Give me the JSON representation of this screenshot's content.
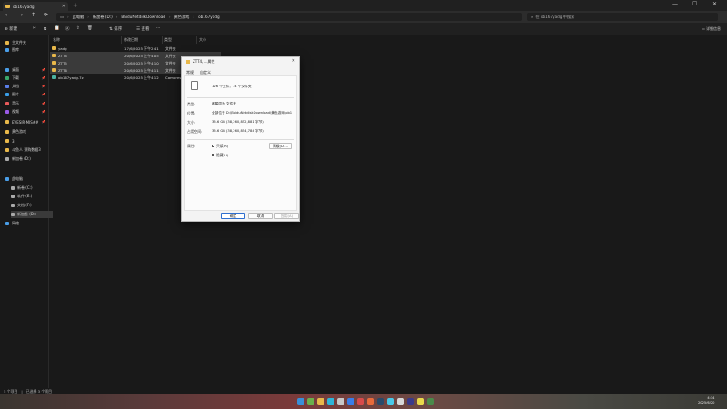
{
  "window": {
    "tab_title": "ob167yadg",
    "tab_close": "✕",
    "new_tab": "+",
    "minimize": "—",
    "maximize": "☐",
    "close": "✕"
  },
  "nav": {
    "back": "←",
    "forward": "→",
    "up": "↑",
    "refresh": "⟳",
    "view": "▭"
  },
  "breadcrumb": [
    "此电脑",
    "新加卷 (D:)",
    "BaiduNetdiskDownload",
    "黄色游戏",
    "ob167yadg"
  ],
  "breadcrumb_sep": "›",
  "search": {
    "placeholder": "在 ob167yadg 中搜索"
  },
  "toolbar": {
    "new_label": "新建",
    "sort_label": "排序",
    "view_label": "查看",
    "more_label": "···",
    "details_label": "详细信息"
  },
  "sidebar": {
    "items": [
      {
        "label": "主文件夹",
        "color": "#e8b84a"
      },
      {
        "label": "图库",
        "color": "#4a9ee8"
      },
      {
        "label": "桌面",
        "color": "#4a9ee8",
        "pin": "📌"
      },
      {
        "label": "下载",
        "color": "#3aa86a",
        "pin": "📌"
      },
      {
        "label": "文档",
        "color": "#5a7ee8",
        "pin": "📌"
      },
      {
        "label": "图片",
        "color": "#3a9ee8",
        "pin": "📌"
      },
      {
        "label": "音乐",
        "color": "#e85a5a",
        "pin": "📌"
      },
      {
        "label": "视频",
        "color": "#9a5ae8",
        "pin": "📌"
      },
      {
        "label": "EVESIR-MIS##",
        "color": "#e8b84a",
        "pin": "📌"
      },
      {
        "label": "黄色游戏",
        "color": "#e8b84a"
      },
      {
        "label": "3",
        "color": "#e8b84a"
      },
      {
        "label": "斗鱼人 预购数据3",
        "color": "#e8b84a"
      },
      {
        "label": "新加卷 (D:)",
        "color": "#aaaaaa"
      },
      {
        "label": "此电脑",
        "color": "#4a9ee8"
      },
      {
        "label": "新卷 (C:)",
        "color": "#aaaaaa"
      },
      {
        "label": "软件 (E:)",
        "color": "#aaaaaa"
      },
      {
        "label": "文档 (F:)",
        "color": "#aaaaaa"
      },
      {
        "label": "新加卷 (D:)",
        "color": "#aaaaaa"
      },
      {
        "label": "网络",
        "color": "#4a9ee8"
      }
    ]
  },
  "columns": [
    "名称",
    "修改日期",
    "类型",
    "大小"
  ],
  "files": [
    {
      "name": "yadg",
      "date": "17/6/2025 下午2:41",
      "type": "文件夹",
      "size": "",
      "kind": "folder",
      "selected": false
    },
    {
      "name": "ZTT4",
      "date": "20/6/2025 上午4:05",
      "type": "文件夹",
      "size": "",
      "kind": "folder",
      "selected": true
    },
    {
      "name": "ZTT5",
      "date": "20/6/2025 上午4:10",
      "type": "文件夹",
      "size": "",
      "kind": "folder",
      "selected": true
    },
    {
      "name": "ZTT6",
      "date": "20/6/2025 上午4:11",
      "type": "文件夹",
      "size": "",
      "kind": "folder",
      "selected": true
    },
    {
      "name": "ob167yadg.7z",
      "date": "20/6/2025 上午4:12",
      "type": "Compressed",
      "size": "",
      "kind": "archive",
      "selected": false
    }
  ],
  "status": {
    "count": "5 个项目",
    "selected": "已选择 3 个项目"
  },
  "dialog": {
    "title": "ZTT4, ...属性",
    "close": "✕",
    "tabs": [
      "常规",
      "自定义"
    ],
    "summary": "126 个文件，14 个文件夹",
    "rows": [
      {
        "label": "类型:",
        "value": "都属同为 文件夹"
      },
      {
        "label": "位置:",
        "value": "全部位于 D:\\BaiduNetdiskDownload\\黄色游戏\\ob1"
      },
      {
        "label": "大小:",
        "value": "35.6 GB (38,260,852,881 字节)"
      },
      {
        "label": "占用空间:",
        "value": "35.6 GB (38,260,854,784 字节)"
      }
    ],
    "attributes_label": "属性:",
    "readonly_label": "只读(R)",
    "hidden_label": "隐藏(H)",
    "advanced_label": "高级(D)...",
    "ok": "确定",
    "cancel": "取消",
    "apply": "应用(A)"
  },
  "taskbar": {
    "icons": [
      {
        "name": "search-icon",
        "color": "#3a8fd8"
      },
      {
        "name": "widgets-icon",
        "color": "#6ab04c"
      },
      {
        "name": "explorer-icon",
        "color": "#e8b84a"
      },
      {
        "name": "chat-icon",
        "color": "#2fb5d9"
      },
      {
        "name": "app-icon-1",
        "color": "#c8c8c8"
      },
      {
        "name": "store-icon",
        "color": "#3a7ee8"
      },
      {
        "name": "app-icon-2",
        "color": "#d84a4a"
      },
      {
        "name": "app-icon-3",
        "color": "#e86a3a"
      },
      {
        "name": "steam-icon",
        "color": "#2a4a6a"
      },
      {
        "name": "app-icon-4",
        "color": "#4ac8e8"
      },
      {
        "name": "app-icon-5",
        "color": "#d8d8d8"
      },
      {
        "name": "app-icon-6",
        "color": "#3a3a8a"
      },
      {
        "name": "app-icon-7",
        "color": "#e8d84a"
      },
      {
        "name": "app-icon-8",
        "color": "#4a8a4a"
      }
    ],
    "time": "4:14",
    "date": "2025/6/20"
  }
}
